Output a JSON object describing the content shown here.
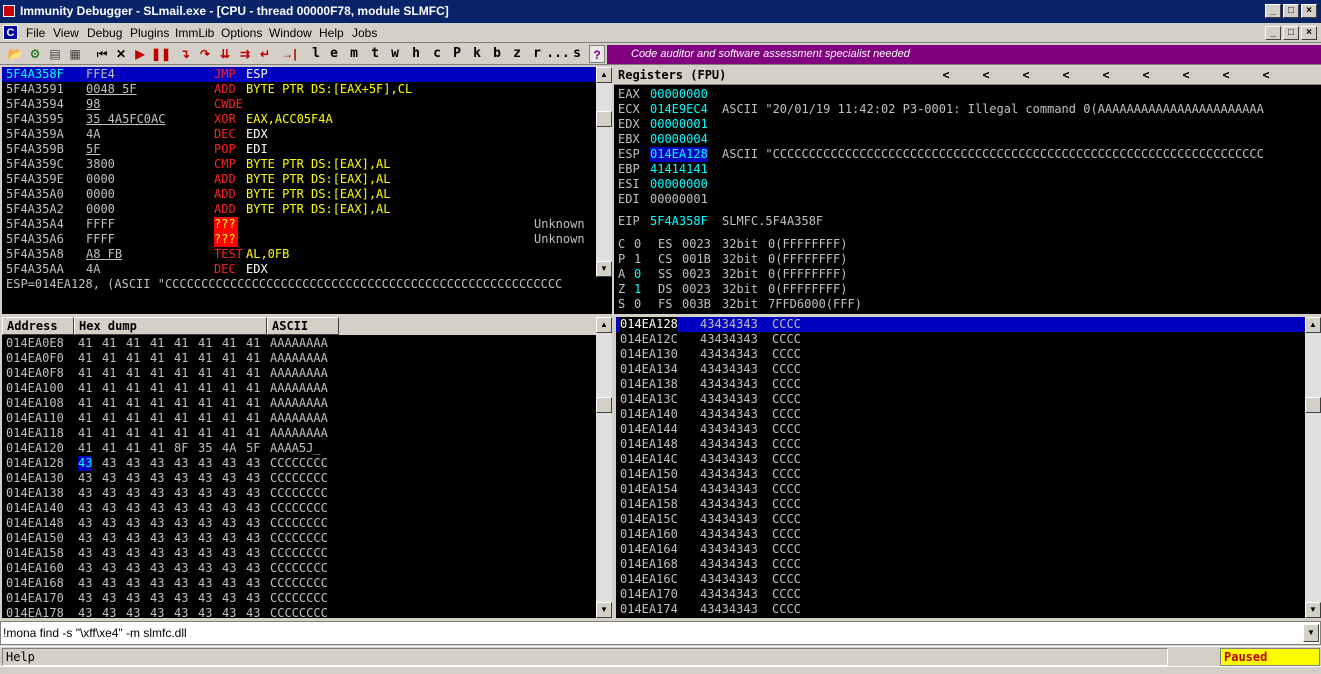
{
  "window": {
    "title": "Immunity Debugger - SLmail.exe - [CPU - thread 00000F78, module SLMFC]",
    "min": "_",
    "max": "□",
    "close": "×"
  },
  "menu": {
    "badge": "C",
    "items": [
      "File",
      "View",
      "Debug",
      "Plugins",
      "ImmLib",
      "Options",
      "Window",
      "Help",
      "Jobs"
    ],
    "child_min": "_",
    "child_max": "□",
    "child_close": "×"
  },
  "toolbar": {
    "open": "📂",
    "restart": "⏮",
    "close": "✕",
    "run": "▶",
    "pause": "❚❚",
    "step_into": "↴",
    "step_over": "↷",
    "trace_into": "⇊",
    "trace_over": "⇉",
    "exec_till_return": "↵",
    "goto": "→|",
    "letters": [
      "l",
      "e",
      "m",
      "t",
      "w",
      "h",
      "c",
      "P",
      "k",
      "b",
      "z",
      "r",
      "...",
      "s"
    ],
    "help": "?",
    "banner": "Code auditor and software assessment specialist needed"
  },
  "disasm": {
    "rows": [
      {
        "addr": "5F4A358F",
        "bytes": "FFE4",
        "mnem": "JMP",
        "ops": "ESP",
        "comment": ""
      },
      {
        "addr": "5F4A3591",
        "bytes": "0048 5F",
        "mnem": "ADD",
        "ops": "BYTE PTR DS:[EAX+5F],CL",
        "comment": ""
      },
      {
        "addr": "5F4A3594",
        "bytes": "98",
        "mnem": "CWDE",
        "ops": "",
        "comment": ""
      },
      {
        "addr": "5F4A3595",
        "bytes": "35 4A5FC0AC",
        "mnem": "XOR",
        "ops": "EAX,ACC05F4A",
        "comment": ""
      },
      {
        "addr": "5F4A359A",
        "bytes": "4A",
        "mnem": "DEC",
        "ops": "EDX",
        "comment": ""
      },
      {
        "addr": "5F4A359B",
        "bytes": "5F",
        "mnem": "POP",
        "ops": "EDI",
        "comment": ""
      },
      {
        "addr": "5F4A359C",
        "bytes": "3800",
        "mnem": "CMP",
        "ops": "BYTE PTR DS:[EAX],AL",
        "comment": ""
      },
      {
        "addr": "5F4A359E",
        "bytes": "0000",
        "mnem": "ADD",
        "ops": "BYTE PTR DS:[EAX],AL",
        "comment": ""
      },
      {
        "addr": "5F4A35A0",
        "bytes": "0000",
        "mnem": "ADD",
        "ops": "BYTE PTR DS:[EAX],AL",
        "comment": ""
      },
      {
        "addr": "5F4A35A2",
        "bytes": "0000",
        "mnem": "ADD",
        "ops": "BYTE PTR DS:[EAX],AL",
        "comment": ""
      },
      {
        "addr": "5F4A35A4",
        "bytes": "FFFF",
        "mnem": "???",
        "ops": "",
        "comment": "Unknown"
      },
      {
        "addr": "5F4A35A6",
        "bytes": "FFFF",
        "mnem": "???",
        "ops": "",
        "comment": "Unknown"
      },
      {
        "addr": "5F4A35A8",
        "bytes": "A8 FB",
        "mnem": "TEST",
        "ops": "AL,0FB",
        "comment": ""
      },
      {
        "addr": "5F4A35AA",
        "bytes": "4A",
        "mnem": "DEC",
        "ops": "EDX",
        "comment": ""
      }
    ],
    "info": "ESP=014EA128, (ASCII \"CCCCCCCCCCCCCCCCCCCCCCCCCCCCCCCCCCCCCCCCCCCCCCCCCCCCCCC"
  },
  "registers": {
    "title": "Registers (FPU)",
    "arrows": [
      "<",
      "<",
      "<",
      "<",
      "<",
      "<",
      "<",
      "<",
      "<"
    ],
    "gp": [
      {
        "name": "EAX",
        "value": "00000000",
        "comment": ""
      },
      {
        "name": "ECX",
        "value": "014E9EC4",
        "comment": "ASCII \"20/01/19 11:42:02 P3-0001: Illegal command 0(AAAAAAAAAAAAAAAAAAAAAAA"
      },
      {
        "name": "EDX",
        "value": "00000001",
        "comment": ""
      },
      {
        "name": "EBX",
        "value": "00000004",
        "comment": ""
      },
      {
        "name": "ESP",
        "value": "014EA128",
        "comment": "ASCII \"CCCCCCCCCCCCCCCCCCCCCCCCCCCCCCCCCCCCCCCCCCCCCCCCCCCCCCCCCCCCCCCCCCCC"
      },
      {
        "name": "EBP",
        "value": "41414141",
        "comment": ""
      },
      {
        "name": "ESI",
        "value": "00000000",
        "comment": ""
      },
      {
        "name": "EDI",
        "value": "00000001",
        "comment": ""
      }
    ],
    "eip": {
      "name": "EIP",
      "value": "5F4A358F",
      "comment": "SLMFC.5F4A358F"
    },
    "flags": [
      {
        "flag": "C",
        "val": "0",
        "seg": "ES",
        "sel": "0023",
        "bits": "32bit",
        "base": "0(FFFFFFFF)"
      },
      {
        "flag": "P",
        "val": "1",
        "seg": "CS",
        "sel": "001B",
        "bits": "32bit",
        "base": "0(FFFFFFFF)"
      },
      {
        "flag": "A",
        "val": "0",
        "seg": "SS",
        "sel": "0023",
        "bits": "32bit",
        "base": "0(FFFFFFFF)"
      },
      {
        "flag": "Z",
        "val": "1",
        "seg": "DS",
        "sel": "0023",
        "bits": "32bit",
        "base": "0(FFFFFFFF)"
      },
      {
        "flag": "S",
        "val": "0",
        "seg": "FS",
        "sel": "003B",
        "bits": "32bit",
        "base": "7FFD6000(FFF)"
      }
    ]
  },
  "dump": {
    "headers": [
      "Address",
      "Hex dump",
      "ASCII"
    ],
    "rows": [
      {
        "addr": "014EA0E8",
        "hex": [
          "41",
          "41",
          "41",
          "41",
          "41",
          "41",
          "41",
          "41"
        ],
        "ascii": "AAAAAAAA"
      },
      {
        "addr": "014EA0F0",
        "hex": [
          "41",
          "41",
          "41",
          "41",
          "41",
          "41",
          "41",
          "41"
        ],
        "ascii": "AAAAAAAA"
      },
      {
        "addr": "014EA0F8",
        "hex": [
          "41",
          "41",
          "41",
          "41",
          "41",
          "41",
          "41",
          "41"
        ],
        "ascii": "AAAAAAAA"
      },
      {
        "addr": "014EA100",
        "hex": [
          "41",
          "41",
          "41",
          "41",
          "41",
          "41",
          "41",
          "41"
        ],
        "ascii": "AAAAAAAA"
      },
      {
        "addr": "014EA108",
        "hex": [
          "41",
          "41",
          "41",
          "41",
          "41",
          "41",
          "41",
          "41"
        ],
        "ascii": "AAAAAAAA"
      },
      {
        "addr": "014EA110",
        "hex": [
          "41",
          "41",
          "41",
          "41",
          "41",
          "41",
          "41",
          "41"
        ],
        "ascii": "AAAAAAAA"
      },
      {
        "addr": "014EA118",
        "hex": [
          "41",
          "41",
          "41",
          "41",
          "41",
          "41",
          "41",
          "41"
        ],
        "ascii": "AAAAAAAA"
      },
      {
        "addr": "014EA120",
        "hex": [
          "41",
          "41",
          "41",
          "41",
          "8F",
          "35",
          "4A",
          "5F"
        ],
        "ascii": "AAAA5J_"
      },
      {
        "addr": "014EA128",
        "hex": [
          "43",
          "43",
          "43",
          "43",
          "43",
          "43",
          "43",
          "43"
        ],
        "ascii": "CCCCCCCC"
      },
      {
        "addr": "014EA130",
        "hex": [
          "43",
          "43",
          "43",
          "43",
          "43",
          "43",
          "43",
          "43"
        ],
        "ascii": "CCCCCCCC"
      },
      {
        "addr": "014EA138",
        "hex": [
          "43",
          "43",
          "43",
          "43",
          "43",
          "43",
          "43",
          "43"
        ],
        "ascii": "CCCCCCCC"
      },
      {
        "addr": "014EA140",
        "hex": [
          "43",
          "43",
          "43",
          "43",
          "43",
          "43",
          "43",
          "43"
        ],
        "ascii": "CCCCCCCC"
      },
      {
        "addr": "014EA148",
        "hex": [
          "43",
          "43",
          "43",
          "43",
          "43",
          "43",
          "43",
          "43"
        ],
        "ascii": "CCCCCCCC"
      },
      {
        "addr": "014EA150",
        "hex": [
          "43",
          "43",
          "43",
          "43",
          "43",
          "43",
          "43",
          "43"
        ],
        "ascii": "CCCCCCCC"
      },
      {
        "addr": "014EA158",
        "hex": [
          "43",
          "43",
          "43",
          "43",
          "43",
          "43",
          "43",
          "43"
        ],
        "ascii": "CCCCCCCC"
      },
      {
        "addr": "014EA160",
        "hex": [
          "43",
          "43",
          "43",
          "43",
          "43",
          "43",
          "43",
          "43"
        ],
        "ascii": "CCCCCCCC"
      },
      {
        "addr": "014EA168",
        "hex": [
          "43",
          "43",
          "43",
          "43",
          "43",
          "43",
          "43",
          "43"
        ],
        "ascii": "CCCCCCCC"
      },
      {
        "addr": "014EA170",
        "hex": [
          "43",
          "43",
          "43",
          "43",
          "43",
          "43",
          "43",
          "43"
        ],
        "ascii": "CCCCCCCC"
      },
      {
        "addr": "014EA178",
        "hex": [
          "43",
          "43",
          "43",
          "43",
          "43",
          "43",
          "43",
          "43"
        ],
        "ascii": "CCCCCCCC"
      }
    ]
  },
  "stack": {
    "rows": [
      {
        "addr": "014EA128",
        "value": "43434343",
        "ascii": "CCCC"
      },
      {
        "addr": "014EA12C",
        "value": "43434343",
        "ascii": "CCCC"
      },
      {
        "addr": "014EA130",
        "value": "43434343",
        "ascii": "CCCC"
      },
      {
        "addr": "014EA134",
        "value": "43434343",
        "ascii": "CCCC"
      },
      {
        "addr": "014EA138",
        "value": "43434343",
        "ascii": "CCCC"
      },
      {
        "addr": "014EA13C",
        "value": "43434343",
        "ascii": "CCCC"
      },
      {
        "addr": "014EA140",
        "value": "43434343",
        "ascii": "CCCC"
      },
      {
        "addr": "014EA144",
        "value": "43434343",
        "ascii": "CCCC"
      },
      {
        "addr": "014EA148",
        "value": "43434343",
        "ascii": "CCCC"
      },
      {
        "addr": "014EA14C",
        "value": "43434343",
        "ascii": "CCCC"
      },
      {
        "addr": "014EA150",
        "value": "43434343",
        "ascii": "CCCC"
      },
      {
        "addr": "014EA154",
        "value": "43434343",
        "ascii": "CCCC"
      },
      {
        "addr": "014EA158",
        "value": "43434343",
        "ascii": "CCCC"
      },
      {
        "addr": "014EA15C",
        "value": "43434343",
        "ascii": "CCCC"
      },
      {
        "addr": "014EA160",
        "value": "43434343",
        "ascii": "CCCC"
      },
      {
        "addr": "014EA164",
        "value": "43434343",
        "ascii": "CCCC"
      },
      {
        "addr": "014EA168",
        "value": "43434343",
        "ascii": "CCCC"
      },
      {
        "addr": "014EA16C",
        "value": "43434343",
        "ascii": "CCCC"
      },
      {
        "addr": "014EA170",
        "value": "43434343",
        "ascii": "CCCC"
      },
      {
        "addr": "014EA174",
        "value": "43434343",
        "ascii": "CCCC"
      }
    ]
  },
  "command": {
    "value": "!mona find -s \"\\xff\\xe4\" -m slmfc.dll",
    "dropdown": "▼"
  },
  "status": {
    "help": "Help",
    "state": "Paused"
  },
  "colors": {
    "selection": "#0000c0",
    "mnemonic": "#ffff00",
    "register_changed": "#00ffff",
    "banner": "#800080",
    "paused_bg": "#ffff00"
  }
}
